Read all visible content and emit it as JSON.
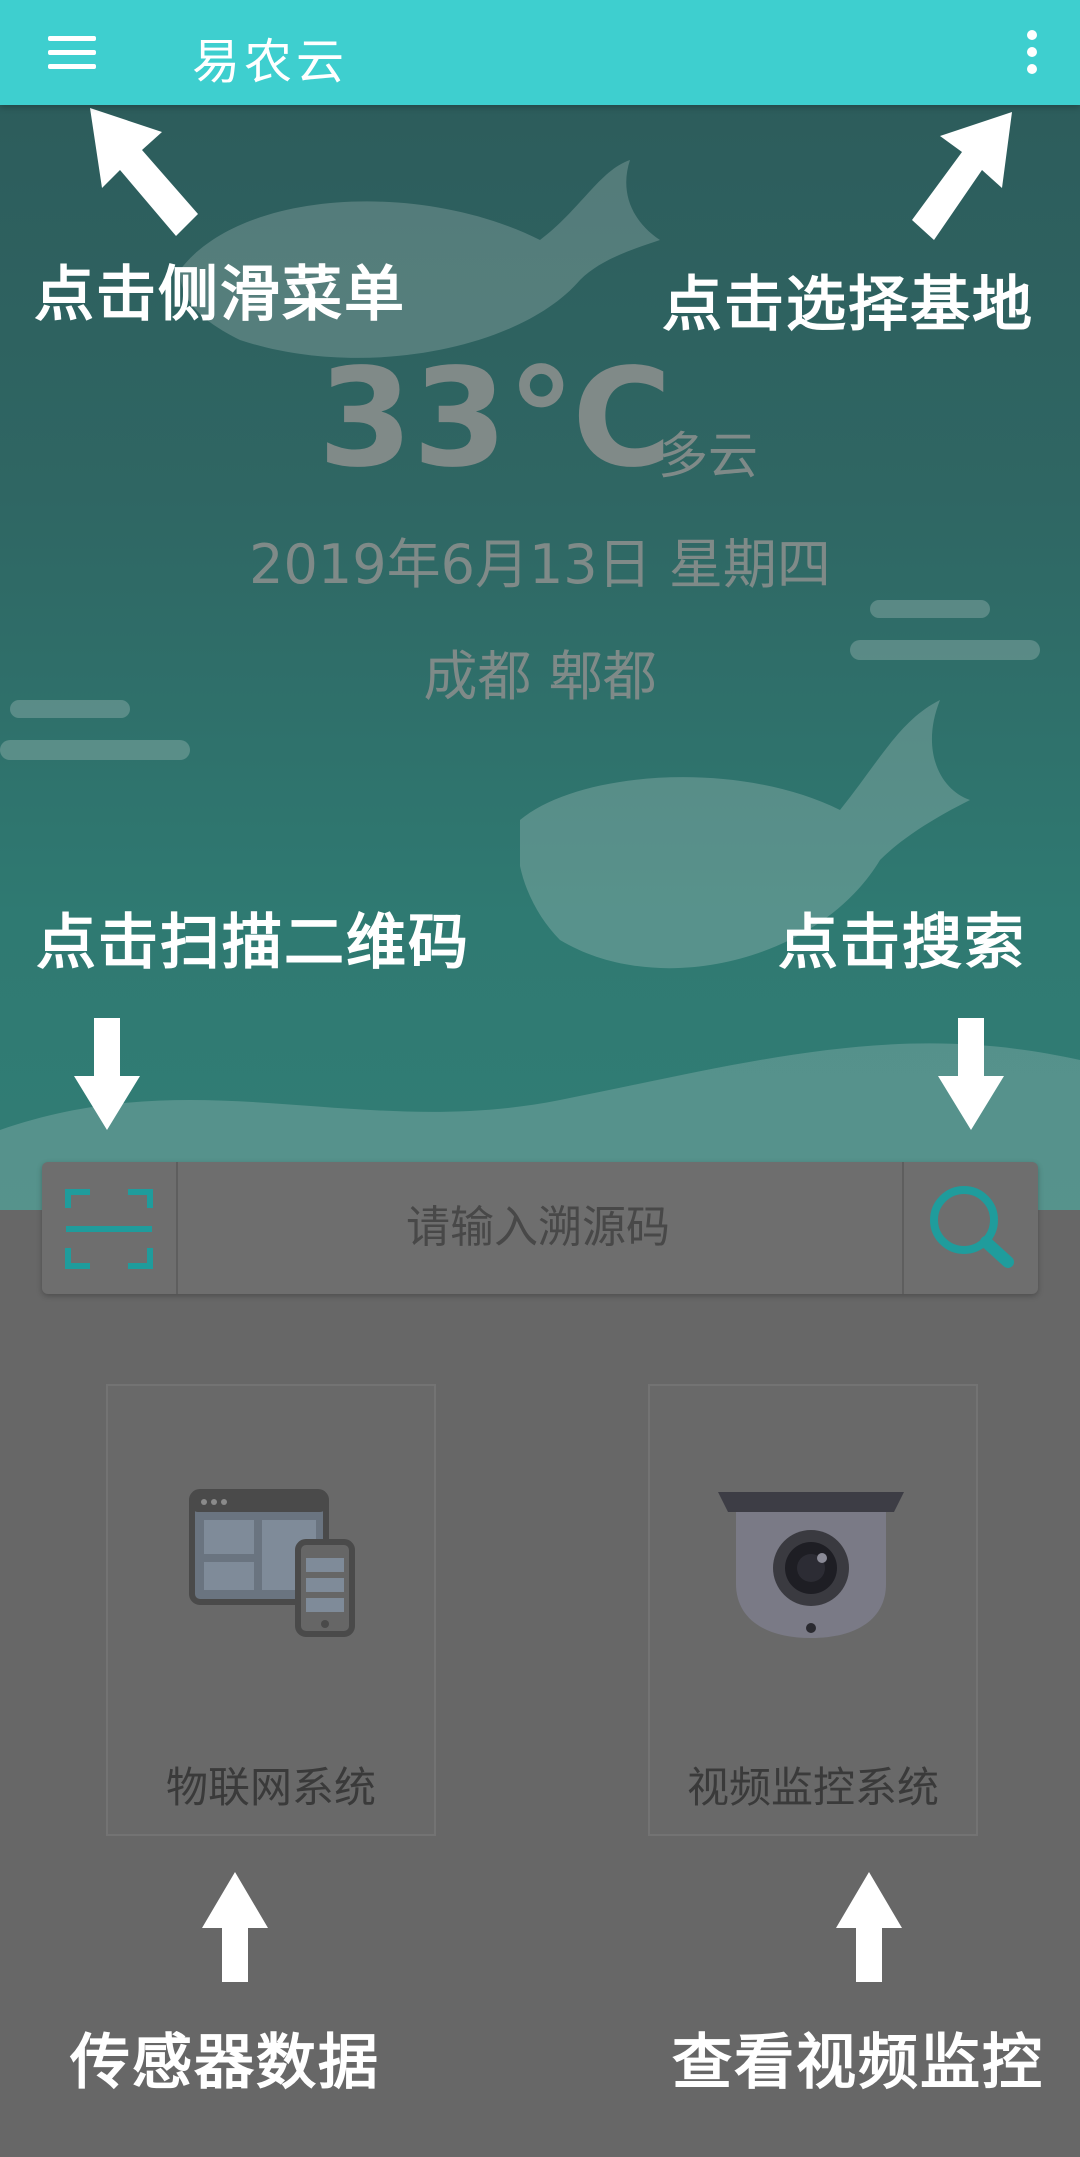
{
  "topbar": {
    "title": "易农云",
    "menu_icon": "hamburger-menu-icon",
    "more_icon": "more-vert-icon",
    "bg_color": "#3ecfcf"
  },
  "weather": {
    "temperature": "33℃",
    "condition": "多云",
    "date": "2019年6月13日 星期四",
    "location": "成都 郫都"
  },
  "annotations": {
    "side_menu": "点击侧滑菜单",
    "select_base": "点击选择基地",
    "scan_qr": "点击扫描二维码",
    "search": "点击搜索",
    "sensor_data": "传感器数据",
    "view_video": "查看视频监控"
  },
  "search": {
    "placeholder": "请输入溯源码",
    "scan_icon": "scan-qr-icon",
    "search_icon": "magnifier-icon",
    "accent_color": "#1f9c9c"
  },
  "tiles": [
    {
      "label": "物联网系统",
      "icon": "iot-devices-icon"
    },
    {
      "label": "视频监控系统",
      "icon": "security-camera-icon"
    }
  ]
}
